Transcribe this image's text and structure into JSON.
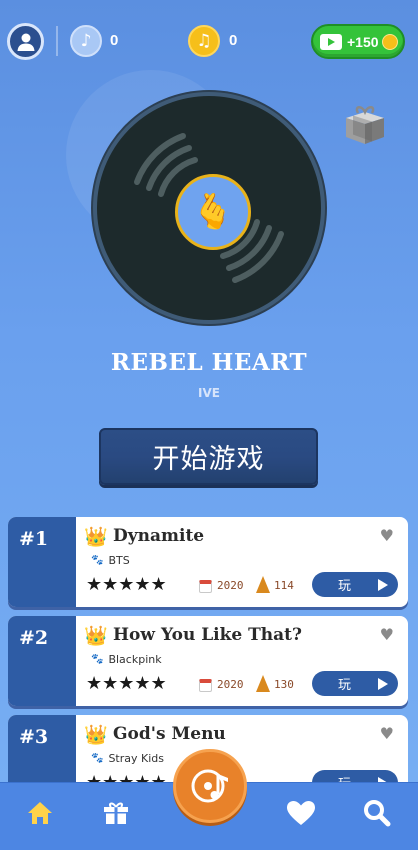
{
  "header": {
    "notes_count": "0",
    "coins_count": "0",
    "reward_label": "+150"
  },
  "now_playing": {
    "title": "REBEL HEART",
    "artist": "IVE",
    "cover_emoji": "🫰",
    "start_label": "开始游戏"
  },
  "songs": [
    {
      "rank": "#1",
      "title": "Dynamite",
      "artist": "BTS",
      "stars": "★★★★★",
      "year": "2020",
      "bpm": "114",
      "play_label": "玩"
    },
    {
      "rank": "#2",
      "title": "How You Like That?",
      "artist": "Blackpink",
      "stars": "★★★★★",
      "year": "2020",
      "bpm": "130",
      "play_label": "玩"
    },
    {
      "rank": "#3",
      "title": "God's Menu",
      "artist": "Stray Kids",
      "stars": "★★★★★",
      "year": "",
      "bpm": "",
      "play_label": "玩"
    }
  ],
  "bottom_nav": {
    "items": [
      "home-icon",
      "gift-icon",
      "music-disc-icon",
      "heart-icon",
      "search-icon"
    ]
  },
  "colors": {
    "background": "#6aa0ee",
    "primary": "#2e5ca5",
    "accent_green": "#34c33a",
    "accent_orange": "#e8822a",
    "gold": "#f6bf1a"
  }
}
